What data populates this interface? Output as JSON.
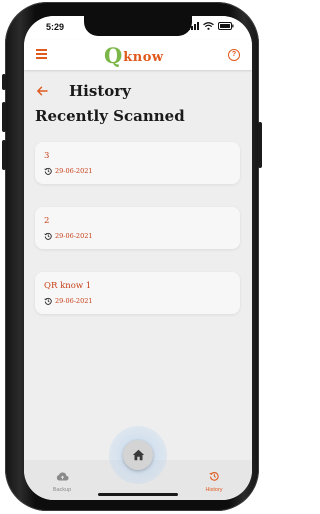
{
  "status_bar": {
    "time": "5:29"
  },
  "app_bar": {
    "logo_q": "Q",
    "logo_know": "know",
    "help_label": "?"
  },
  "page": {
    "title": "History",
    "section_title": "Recently Scanned"
  },
  "history_items": [
    {
      "title": "3",
      "date": "29-06-2021"
    },
    {
      "title": "2",
      "date": "29-06-2021"
    },
    {
      "title": "QR know 1",
      "date": "29-06-2021"
    }
  ],
  "bottom_nav": {
    "backup_label": "Backup",
    "history_label": "History"
  },
  "colors": {
    "accent": "#e05a1e",
    "item_text": "#c8401a",
    "logo_green": "#7ab648",
    "background": "#eeeeee"
  }
}
